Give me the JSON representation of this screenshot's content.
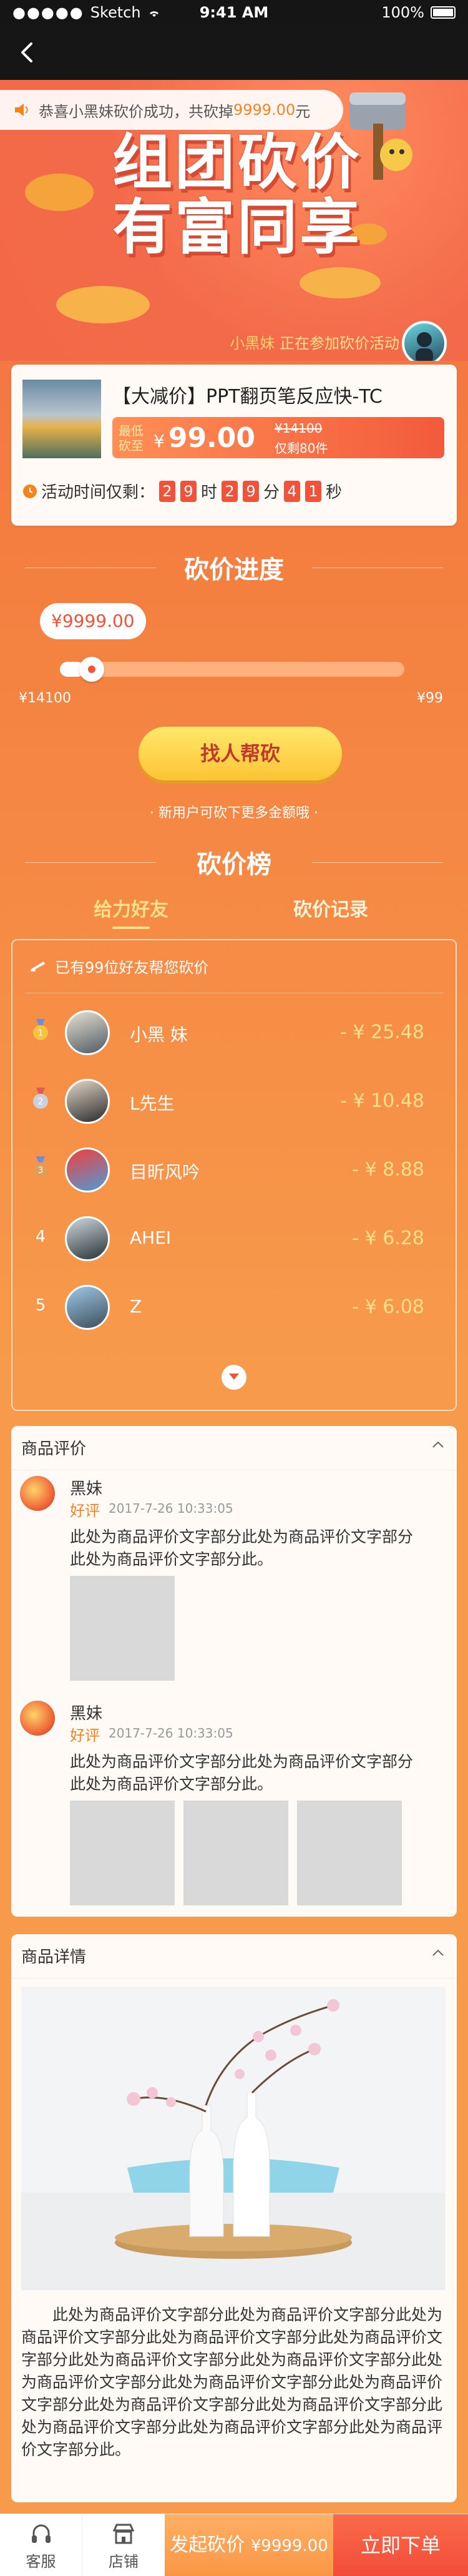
{
  "status_bar": {
    "carrier": "Sketch",
    "time": "9:41 AM",
    "battery": "100%"
  },
  "notice": {
    "prefix": "恭喜小黑妹砍价成功，共砍掉",
    "amount": "9999.00",
    "suffix": "元"
  },
  "hero": {
    "title_line1": "组团砍价",
    "title_line2": "有富同享"
  },
  "participant": {
    "name": "小黑妹",
    "text": "正在参加砍价活动"
  },
  "product": {
    "title": "【大减价】PPT翻页笔反应快-TC",
    "lowest_label": "最低砍至",
    "currency": "¥",
    "price": "99.00",
    "original_price": "¥14100",
    "stock": "仅剩80件",
    "countdown_label": "活动时间仅剩：",
    "countdown": {
      "h1": "2",
      "h2": "9",
      "h_unit": "时",
      "m1": "2",
      "m2": "9",
      "m_unit": "分",
      "s1": "4",
      "s2": "1",
      "s_unit": "秒"
    }
  },
  "progress": {
    "title": "砍价进度",
    "current": "¥9999.00",
    "start": "¥14100",
    "end": "¥99",
    "fraction": 0.07,
    "help_button": "找人帮砍",
    "tip": "· 新用户可砍下更多金额哦 ·"
  },
  "leaderboard": {
    "title": "砍价榜",
    "tabs": [
      "给力好友",
      "砍价记录"
    ],
    "header": "已有99位好友帮您砍价",
    "rows": [
      {
        "rank": "1",
        "name": "小黑 妹",
        "amount": "- ¥ 25.48",
        "medal": "gold"
      },
      {
        "rank": "2",
        "name": "L先生",
        "amount": "- ¥ 10.48",
        "medal": "silver"
      },
      {
        "rank": "3",
        "name": "目昕风吟",
        "amount": "- ¥ 8.88",
        "medal": "bronze"
      },
      {
        "rank": "4",
        "name": "AHEI",
        "amount": "- ¥ 6.28",
        "medal": ""
      },
      {
        "rank": "5",
        "name": "Z",
        "amount": "- ¥ 6.08",
        "medal": ""
      }
    ]
  },
  "reviews": {
    "title": "商品评价",
    "items": [
      {
        "name": "黑妹",
        "tag": "好评",
        "date": "2017-7-26    10:33:05",
        "text": "此处为商品评价文字部分此处为商品评价文字部分此处为商品评价文字部分此。",
        "images": 1
      },
      {
        "name": "黑妹",
        "tag": "好评",
        "date": "2017-7-26    10:33:05",
        "text": "此处为商品评价文字部分此处为商品评价文字部分此处为商品评价文字部分此。",
        "images": 3
      }
    ]
  },
  "details": {
    "title": "商品详情",
    "text": "此处为商品评价文字部分此处为商品评价文字部分此处为商品评价文字部分此处为商品评价文字部分此处为商品评价文字部分此处为商品评价文字部分此处为商品评价文字部分此处为商品评价文字部分此处为商品评价文字部分此处为商品评价文字部分此处为商品评价文字部分此处为商品评价文字部分此处为商品评价文字部分此处为商品评价文字部分此处为商品评价文字部分此。"
  },
  "bottom_bar": {
    "service": "客服",
    "shop": "店铺",
    "bargain_label": "发起砍价",
    "bargain_price": "¥9999.00",
    "buy": "立即下单"
  },
  "colors": {
    "accent": "#f0533a",
    "gold": "#ffe08a",
    "orange": "#f79a4b"
  }
}
